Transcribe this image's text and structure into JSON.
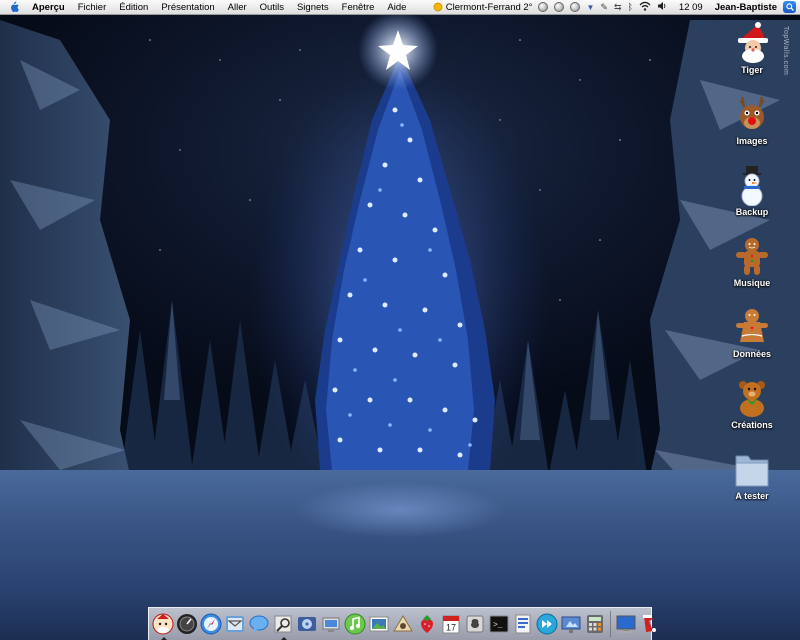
{
  "menubar": {
    "app_name": "Aperçu",
    "items": [
      "Fichier",
      "Édition",
      "Présentation",
      "Aller",
      "Outils",
      "Signets",
      "Fenêtre",
      "Aide"
    ],
    "weather": "Clermont-Ferrand 2°",
    "clock": "12 09",
    "user": "Jean-Baptiste"
  },
  "desktop": {
    "icons": [
      {
        "label": "Tiger",
        "icon": "santa-icon"
      },
      {
        "label": "Images",
        "icon": "reindeer-icon"
      },
      {
        "label": "Backup",
        "icon": "snowman-icon"
      },
      {
        "label": "Musique",
        "icon": "gingerbread-icon"
      },
      {
        "label": "Données",
        "icon": "gingerbread-girl-icon"
      },
      {
        "label": "Créations",
        "icon": "teddy-bear-icon"
      },
      {
        "label": "A tester",
        "icon": "folder-icon"
      }
    ],
    "watermark": "TopWalls.com"
  },
  "dock": {
    "items": [
      "finder-icon",
      "dashboard-icon",
      "safari-icon",
      "mail-icon",
      "ichat-icon",
      "preview-icon",
      "dvd-icon",
      "network-icon",
      "itunes-icon",
      "iphoto-icon",
      "imovie-icon",
      "strawberry-icon",
      "ical-icon",
      "system-preferences-icon",
      "terminal-icon",
      "app-icon",
      "quicksilver-icon",
      "keynote-icon",
      "calculator-icon",
      "desktop-icon",
      "trash-icon"
    ],
    "calendar_day": "17"
  }
}
